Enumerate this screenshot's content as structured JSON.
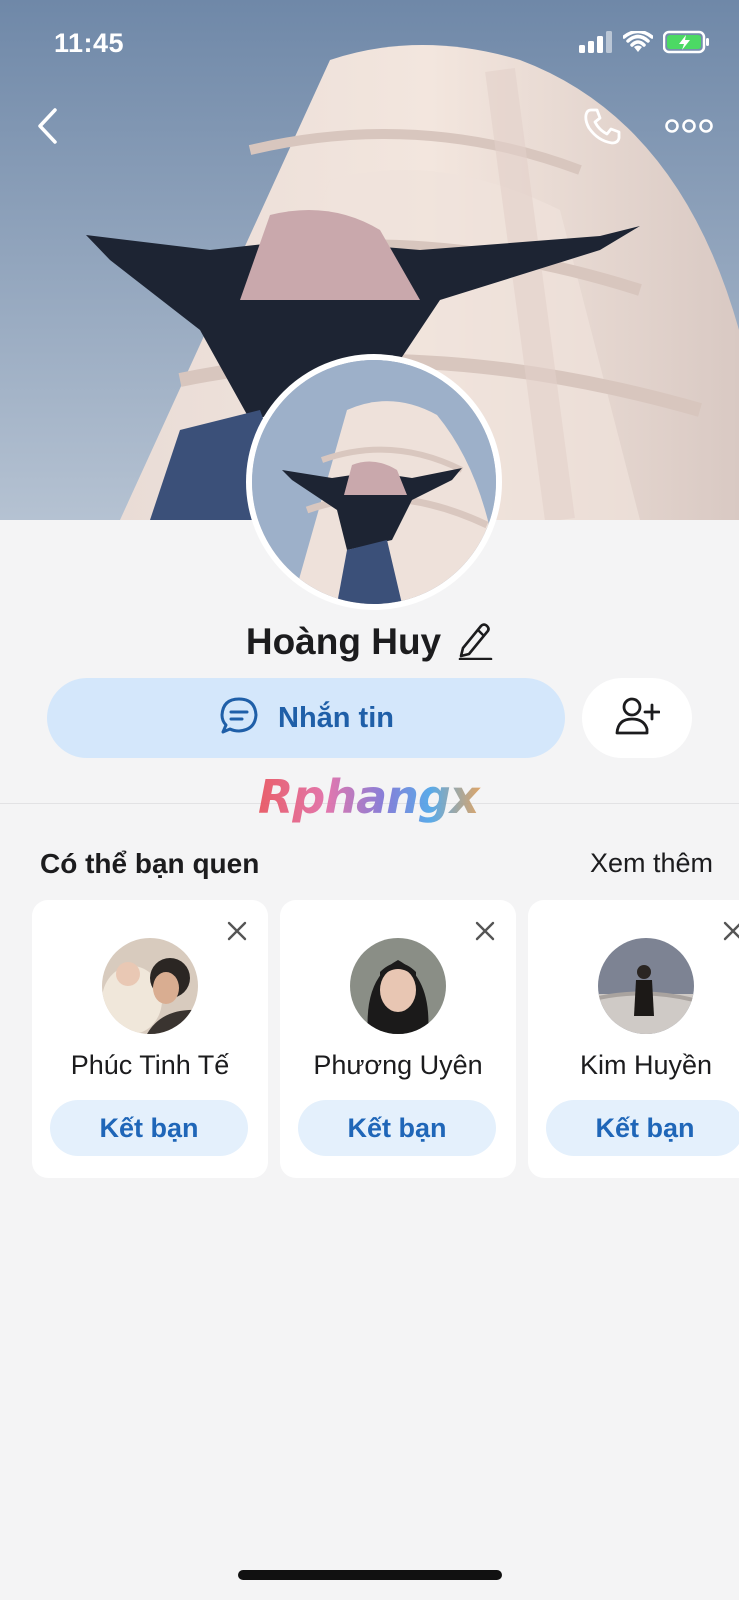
{
  "status_bar": {
    "time": "11:45"
  },
  "profile": {
    "name": "Hoàng Huy"
  },
  "actions": {
    "message_label": "Nhắn tin"
  },
  "watermark": "Rphangx",
  "suggestions": {
    "title": "Có thể bạn quen",
    "see_more": "Xem thêm",
    "people": [
      {
        "name": "Phúc Tinh Tế",
        "button": "Kết bạn"
      },
      {
        "name": "Phương Uyên",
        "button": "Kết bạn"
      },
      {
        "name": "Kim Huyền",
        "button": "Kết bạn"
      }
    ]
  },
  "colors": {
    "accent": "#1f66b8",
    "message_button_bg": "#d4e7fb",
    "add_button_bg": "#e4f0fc",
    "page_bg": "#f4f4f5"
  },
  "icons": {
    "back": "chevron-left-icon",
    "call": "phone-icon",
    "more": "more-dots-icon",
    "edit": "pencil-icon",
    "message": "chat-bubble-icon",
    "add_friend": "user-plus-icon",
    "close": "close-icon"
  }
}
